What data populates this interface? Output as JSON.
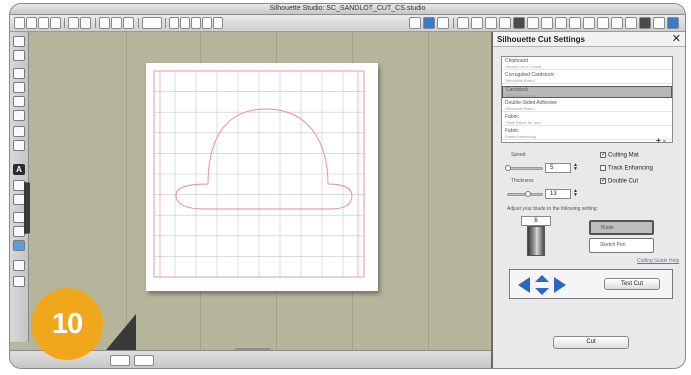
{
  "window": {
    "title": "Silhouette Studio: SC_SANDLOT_CUT_CS.studio"
  },
  "panel": {
    "title": "Silhouette Cut Settings",
    "close_glyph": "✕",
    "materials": [
      {
        "name": "Chipboard",
        "sub": "Alcohol Ink w/ Cricut"
      },
      {
        "name": "Corrugated Cardstock",
        "sub": "Silhouette Brand"
      },
      {
        "name": "Cardstock",
        "sub": "Silhouette Brand"
      },
      {
        "name": "Double-Sided Adhesive",
        "sub": "Silhouette Brand"
      },
      {
        "name": "Fabric",
        "sub": "Thick Fabric for Iron"
      },
      {
        "name": "Fabric",
        "sub": "Fabric Interfacing"
      }
    ],
    "selected_material_index": 2,
    "list_buttons": "+ -",
    "speed_label": "Speed",
    "speed_value": "5",
    "thickness_label": "Thickness",
    "thickness_value": "13",
    "cutting_mat_label": "Cutting Mat",
    "track_enhancing_label": "Track Enhancing",
    "double_cut_label": "Double Cut",
    "check_glyph": "✓",
    "blade_instruction": "Adjust your blade to the following setting:",
    "blade_setting": "6",
    "blade_options": [
      "Blade",
      "Sketch Pen"
    ],
    "help_link": "Cutting Guide Help",
    "test_cut_label": "Test Cut",
    "cut_label": "Cut"
  },
  "badge": {
    "number": "10"
  },
  "colors": {
    "badge": "#f0a71c",
    "arrows": "#2b67c7",
    "grid_red": "#e08a94",
    "grid_gray": "#c7c7c7"
  }
}
